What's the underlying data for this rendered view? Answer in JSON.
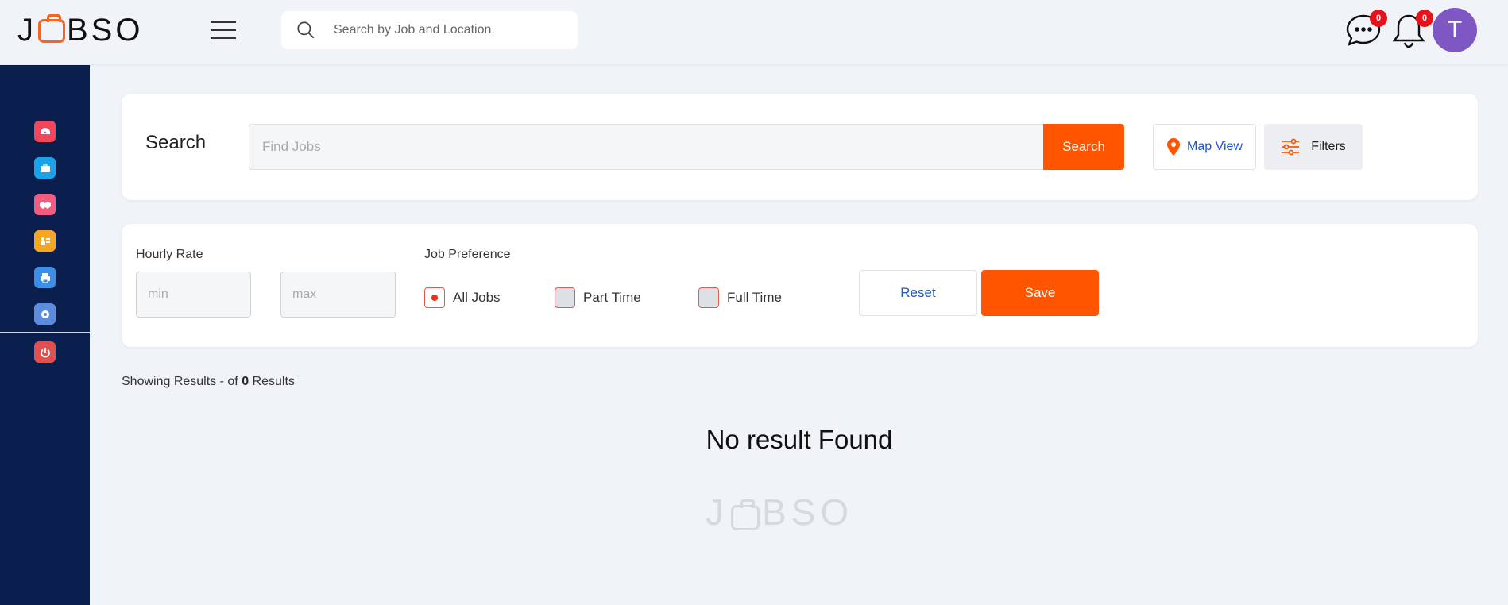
{
  "header": {
    "logo_prefix": "J",
    "logo_suffix": "BSO",
    "search_placeholder": "Search by Job and Location.",
    "messages_badge": "0",
    "notifications_badge": "0",
    "avatar_initial": "T"
  },
  "sidebar": {
    "items": [
      {
        "icon": "dashboard-icon",
        "color": "#f0475a"
      },
      {
        "icon": "briefcase-icon",
        "color": "#1aa3e8"
      },
      {
        "icon": "handshake-icon",
        "color": "#f25c7e"
      },
      {
        "icon": "people-icon",
        "color": "#f5a623"
      },
      {
        "icon": "printer-icon",
        "color": "#3b8fe8"
      },
      {
        "icon": "settings-icon",
        "color": "#5b8ce0"
      },
      {
        "icon": "power-icon",
        "color": "#e05050"
      }
    ]
  },
  "search_card": {
    "title": "Search",
    "find_placeholder": "Find Jobs",
    "search_button": "Search",
    "map_view_button": "Map View",
    "filters_button": "Filters"
  },
  "filters": {
    "hourly_rate_label": "Hourly Rate",
    "min_placeholder": "min",
    "max_placeholder": "max",
    "job_preference_label": "Job Preference",
    "options": [
      {
        "label": "All Jobs",
        "checked": true
      },
      {
        "label": "Part Time",
        "checked": false
      },
      {
        "label": "Full Time",
        "checked": false
      }
    ],
    "reset_button": "Reset",
    "save_button": "Save"
  },
  "results": {
    "prefix": "Showing Results - of ",
    "count": "0",
    "suffix": " Results",
    "empty_message": "No result Found"
  },
  "colors": {
    "brand_orange": "#ff5500",
    "sidebar_bg": "#0b1f4f",
    "link_blue": "#1a56db",
    "avatar": "#7e57c2"
  }
}
